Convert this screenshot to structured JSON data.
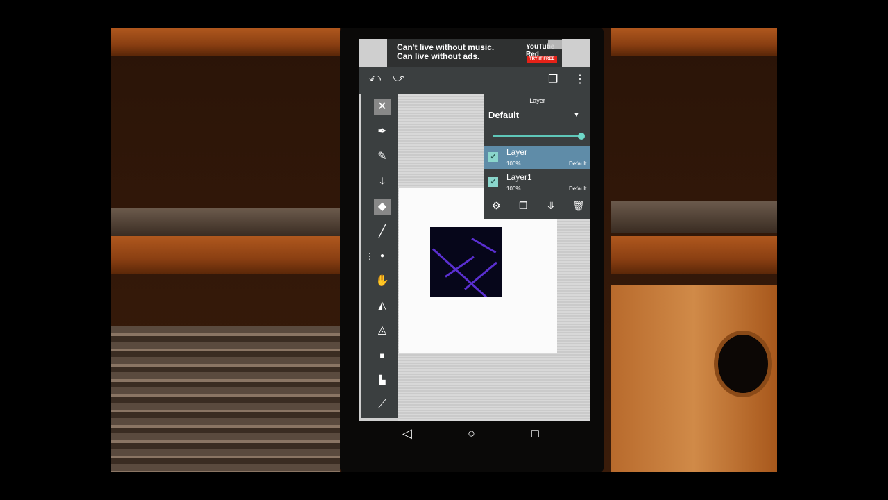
{
  "ad": {
    "line1": "Can't live without music.",
    "line2": "Can live without ads.",
    "brand": "YouTube Red",
    "cta": "TRY IT FREE"
  },
  "topbar": {
    "undo_icon": "undo-icon",
    "redo_icon": "redo-icon",
    "layers_icon": "layers-icon",
    "menu_icon": "more-vert-icon"
  },
  "tools": [
    {
      "name": "close-icon",
      "glyph": "✕"
    },
    {
      "name": "pen-icon",
      "glyph": "✒"
    },
    {
      "name": "pencil-icon",
      "glyph": "✎"
    },
    {
      "name": "brush-icon",
      "glyph": "⤓"
    },
    {
      "name": "eraser-icon",
      "glyph": "◆"
    },
    {
      "name": "line-icon",
      "glyph": "╱"
    },
    {
      "name": "dot-icon",
      "glyph": "●"
    },
    {
      "name": "hand-icon",
      "glyph": "✋"
    },
    {
      "name": "fill-icon",
      "glyph": "◭"
    },
    {
      "name": "blur-icon",
      "glyph": "◬"
    },
    {
      "name": "rect-icon",
      "glyph": "■"
    },
    {
      "name": "bucket-icon",
      "glyph": "▙"
    },
    {
      "name": "eyedropper-icon",
      "glyph": "⟋"
    }
  ],
  "layer_panel": {
    "title": "Layer",
    "blend_mode": "Default",
    "opacity_slider": 1.0,
    "layers": [
      {
        "name": "Layer",
        "opacity": "100%",
        "mode": "Default",
        "selected": true,
        "visible": true
      },
      {
        "name": "Layer1",
        "opacity": "100%",
        "mode": "Default",
        "selected": false,
        "visible": true
      }
    ],
    "actions": [
      "settings-icon",
      "duplicate-icon",
      "merge-icon",
      "delete-icon"
    ]
  },
  "nav": {
    "back": "◁",
    "home": "○",
    "recents": "□"
  }
}
